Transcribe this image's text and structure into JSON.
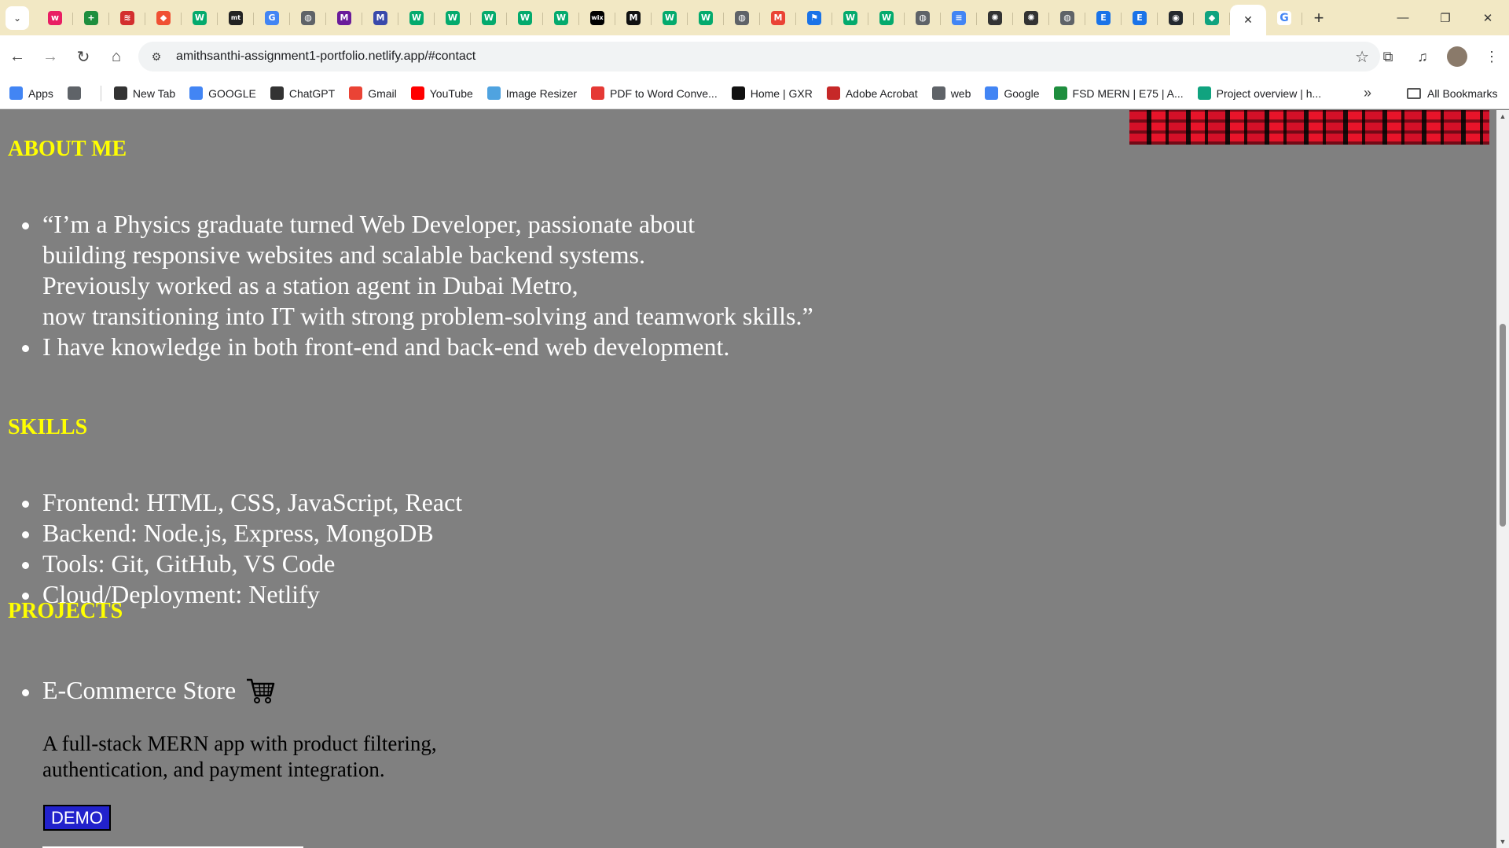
{
  "browser": {
    "tabs": [
      {
        "icon": "wix-icon",
        "color": "#e91e63",
        "glyph": "w"
      },
      {
        "icon": "sheets-plus-icon",
        "color": "#1e8e3e",
        "glyph": "+"
      },
      {
        "icon": "stack-icon",
        "color": "#d32f2f",
        "glyph": "≋"
      },
      {
        "icon": "git-diamond-icon",
        "color": "#f05033",
        "glyph": "◆"
      },
      {
        "icon": "w3-icon",
        "color": "#04aa6d",
        "glyph": "W"
      },
      {
        "icon": "mt-icon",
        "color": "#222222",
        "glyph": "mt"
      },
      {
        "icon": "google-icon",
        "color": "#4285f4",
        "glyph": "G"
      },
      {
        "icon": "globe-icon",
        "color": "#5f6368",
        "glyph": "◍"
      },
      {
        "icon": "m-gradient-icon",
        "color": "#6a1b9a",
        "glyph": "M"
      },
      {
        "icon": "m-gradient-icon-2",
        "color": "#3949ab",
        "glyph": "M"
      },
      {
        "icon": "w3-icon-2",
        "color": "#04aa6d",
        "glyph": "W"
      },
      {
        "icon": "w3-icon-3",
        "color": "#04aa6d",
        "glyph": "W"
      },
      {
        "icon": "w3-icon-4",
        "color": "#04aa6d",
        "glyph": "W"
      },
      {
        "icon": "w3-icon-5",
        "color": "#04aa6d",
        "glyph": "W"
      },
      {
        "icon": "w3-icon-6",
        "color": "#04aa6d",
        "glyph": "W"
      },
      {
        "icon": "wix-logo-icon",
        "color": "#000000",
        "glyph": "wix"
      },
      {
        "icon": "medium-icon",
        "color": "#111111",
        "glyph": "M"
      },
      {
        "icon": "w3-icon-7",
        "color": "#04aa6d",
        "glyph": "W"
      },
      {
        "icon": "w3-icon-8",
        "color": "#04aa6d",
        "glyph": "W"
      },
      {
        "icon": "globe-icon-2",
        "color": "#5f6368",
        "glyph": "◍"
      },
      {
        "icon": "gmail-icon",
        "color": "#ea4335",
        "glyph": "M"
      },
      {
        "icon": "flag-icon",
        "color": "#1a73e8",
        "glyph": "⚑"
      },
      {
        "icon": "w3-icon-9",
        "color": "#04aa6d",
        "glyph": "W"
      },
      {
        "icon": "w3-icon-10",
        "color": "#04aa6d",
        "glyph": "W"
      },
      {
        "icon": "globe-icon-3",
        "color": "#5f6368",
        "glyph": "◍"
      },
      {
        "icon": "docs-icon",
        "color": "#4285f4",
        "glyph": "≡"
      },
      {
        "icon": "chatgpt-icon",
        "color": "#333333",
        "glyph": "✺"
      },
      {
        "icon": "chatgpt-icon-2",
        "color": "#333333",
        "glyph": "✺"
      },
      {
        "icon": "globe-icon-4",
        "color": "#5f6368",
        "glyph": "◍"
      },
      {
        "icon": "edge-e-icon",
        "color": "#1a73e8",
        "glyph": "E"
      },
      {
        "icon": "edge-e-icon-2",
        "color": "#1a73e8",
        "glyph": "E"
      },
      {
        "icon": "github-icon",
        "color": "#24292e",
        "glyph": "◉"
      },
      {
        "icon": "diamond-icon",
        "color": "#10a37f",
        "glyph": "◆"
      }
    ],
    "active_tab_close": "✕",
    "new_tab": "+",
    "url": "amithsanthi-assignment1-portfolio.netlify.app/#contact",
    "bookmarks": [
      {
        "label": "Apps",
        "icon": "apps-grid-icon",
        "color": "#4285f4"
      },
      {
        "label": "",
        "icon": "grid-icon",
        "color": "#5f6368"
      },
      {
        "label": "New Tab",
        "icon": "globe-icon",
        "color": "#333333"
      },
      {
        "label": "GOOGLE",
        "icon": "google-icon",
        "color": "#4285f4"
      },
      {
        "label": "ChatGPT",
        "icon": "chatgpt-icon",
        "color": "#333333"
      },
      {
        "label": "Gmail",
        "icon": "gmail-icon",
        "color": "#ea4335"
      },
      {
        "label": "YouTube",
        "icon": "youtube-icon",
        "color": "#ff0000"
      },
      {
        "label": "Image Resizer",
        "icon": "image-icon",
        "color": "#4fa3e0"
      },
      {
        "label": "PDF to Word Conve...",
        "icon": "pdf-word-icon",
        "color": "#e53935"
      },
      {
        "label": "Home | GXR",
        "icon": "gxr-icon",
        "color": "#111111"
      },
      {
        "label": "Adobe Acrobat",
        "icon": "acrobat-icon",
        "color": "#c62828"
      },
      {
        "label": "web",
        "icon": "folder-icon",
        "color": "#5f6368"
      },
      {
        "label": "Google",
        "icon": "google-icon",
        "color": "#4285f4"
      },
      {
        "label": "FSD MERN | E75 | A...",
        "icon": "sheets-plus-icon",
        "color": "#1e8e3e"
      },
      {
        "label": "Project overview | h...",
        "icon": "diamond-icon",
        "color": "#10a37f"
      }
    ],
    "bookmarks_more": "»",
    "all_bookmarks": "All Bookmarks"
  },
  "page": {
    "about_heading": "ABOUT ME",
    "about_items": [
      "“I’m a Physics graduate turned Web Developer, passionate about",
      "building responsive websites and scalable backend systems.",
      "Previously worked as a station agent in Dubai Metro,",
      "now transitioning into IT with strong problem-solving and teamwork skills.”"
    ],
    "about_item2": "I have knowledge in both front-end and back-end web development.",
    "skills_heading": "SKILLS",
    "skills": [
      "Frontend: HTML, CSS, JavaScript, React",
      "Backend: Node.js, Express, MongoDB",
      "Tools: Git, GitHub, VS Code",
      "Cloud/Deployment: Netlify"
    ],
    "projects_heading": "PROJECTS",
    "project_title": "E-Commerce Store",
    "project_desc_1": "A full-stack MERN app with product filtering,",
    "project_desc_2": "authentication, and payment integration.",
    "demo_label": "DEMO"
  },
  "colors": {
    "heading": "#ffff00",
    "page_bg": "#808080",
    "demo_bg": "#2222cc"
  }
}
